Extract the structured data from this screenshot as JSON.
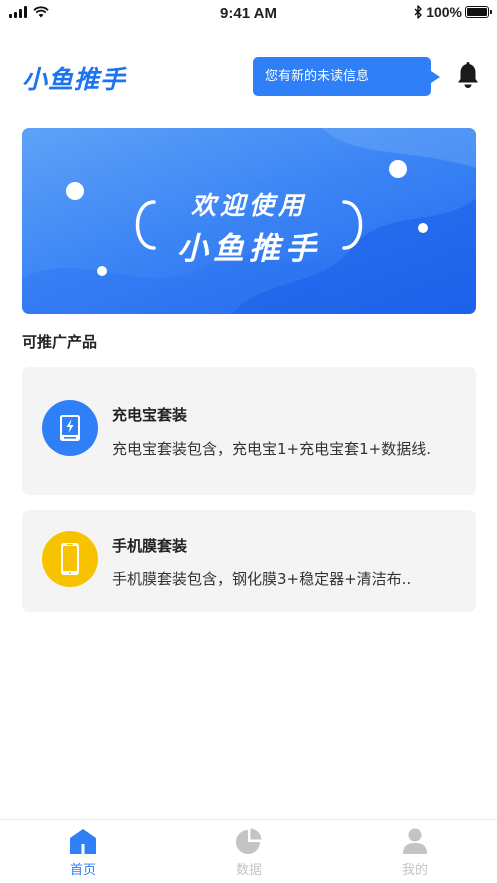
{
  "status_bar": {
    "time": "9:41 AM",
    "battery": "100%"
  },
  "header": {
    "logo": "小鱼推手",
    "notification_tip": "您有新的未读信息"
  },
  "banner": {
    "line1": "欢迎使用",
    "line2": "小鱼推手"
  },
  "section_title": "可推广产品",
  "products": [
    {
      "title": "充电宝套装",
      "desc": "充电宝套装包含，充电宝1+充电宝套1+数据线.",
      "icon": "power-bank-icon",
      "icon_color": "#2f80f6"
    },
    {
      "title": "手机膜套装",
      "desc": "手机膜套装包含，钢化膜3+稳定器+清洁布..",
      "icon": "phone-icon",
      "icon_color": "#f7c300"
    }
  ],
  "tabs": [
    {
      "label": "首页",
      "icon": "home-icon",
      "active": true
    },
    {
      "label": "数据",
      "icon": "pie-chart-icon",
      "active": false
    },
    {
      "label": "我的",
      "icon": "user-icon",
      "active": false
    }
  ],
  "colors": {
    "accent": "#2f80f6",
    "inactive": "#c4c4c4"
  }
}
